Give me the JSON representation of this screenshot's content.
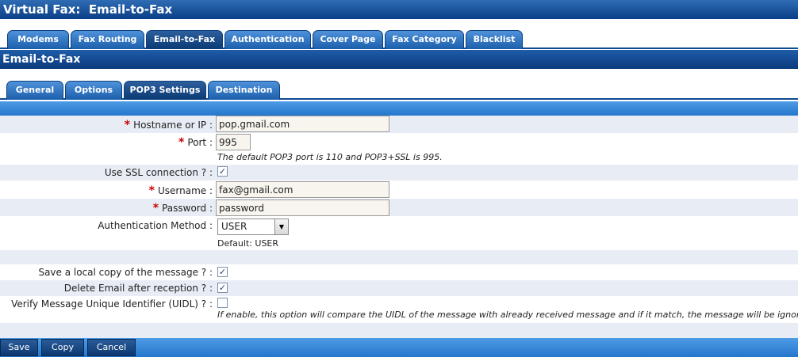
{
  "title": "Virtual Fax:  Email-to-Fax",
  "main_tabs": [
    "Modems",
    "Fax Routing",
    "Email-to-Fax",
    "Authentication",
    "Cover Page",
    "Fax Category",
    "Blacklist"
  ],
  "section_title": "Email-to-Fax",
  "sub_tabs": [
    "General",
    "Options",
    "POP3 Settings",
    "Destination"
  ],
  "form": {
    "hostname": {
      "label": "Hostname or IP :",
      "value": "pop.gmail.com"
    },
    "port": {
      "label": "Port :",
      "value": "995",
      "hint": "The default POP3 port is 110 and POP3+SSL is 995."
    },
    "ssl": {
      "label": "Use SSL connection ? :",
      "checked": true
    },
    "username": {
      "label": "Username :",
      "value": "fax@gmail.com"
    },
    "password": {
      "label": "Password :",
      "value": "password"
    },
    "auth_method": {
      "label": "Authentication Method :",
      "selected": "USER",
      "default_text": "Default: USER"
    },
    "save_copy": {
      "label": "Save a local copy of the message ? :",
      "checked": true
    },
    "delete_email": {
      "label": "Delete Email after reception ? :",
      "checked": true
    },
    "verify_uidl": {
      "label": "Verify Message Unique Identifier (UIDL) ? :",
      "checked": false,
      "hint": "If enable, this option will compare the UIDL of the message with already received message and if it match, the message will be ignored."
    }
  },
  "required_mark": "*",
  "check_mark": "✓",
  "buttons": {
    "save": "Save",
    "copy": "Copy",
    "cancel": "Cancel"
  }
}
